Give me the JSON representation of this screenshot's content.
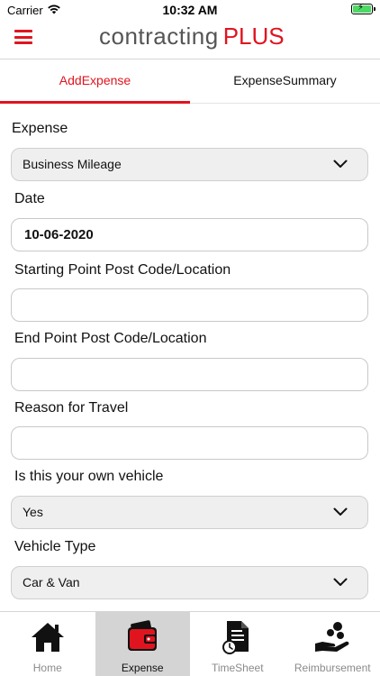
{
  "status_bar": {
    "carrier": "Carrier",
    "time": "10:32 AM",
    "battery_color": "#4cd964"
  },
  "header": {
    "logo_main": "contracting",
    "logo_accent": "PLUS",
    "menu_icon": "hamburger-icon",
    "accent_color": "#e0141f"
  },
  "tabs": [
    {
      "label": "AddExpense",
      "selected": true
    },
    {
      "label": "ExpenseSummary",
      "selected": false
    }
  ],
  "form": {
    "expense": {
      "label": "Expense",
      "value": "Business Mileage"
    },
    "date": {
      "label": "Date",
      "value": "10-06-2020"
    },
    "start_point": {
      "label": "Starting Point Post Code/Location",
      "value": ""
    },
    "end_point": {
      "label": "End Point Post Code/Location",
      "value": ""
    },
    "reason": {
      "label": "Reason for Travel",
      "value": ""
    },
    "own_vehicle": {
      "label": "Is this your own vehicle",
      "value": "Yes"
    },
    "vehicle_type": {
      "label": "Vehicle Type",
      "value": "Car & Van"
    }
  },
  "bottom_nav": [
    {
      "label": "Home",
      "icon": "home-icon",
      "active": false
    },
    {
      "label": "Expense",
      "icon": "wallet-icon",
      "active": true
    },
    {
      "label": "TimeSheet",
      "icon": "timesheet-icon",
      "active": false
    },
    {
      "label": "Reimbursement",
      "icon": "reimbursement-icon",
      "active": false
    }
  ]
}
